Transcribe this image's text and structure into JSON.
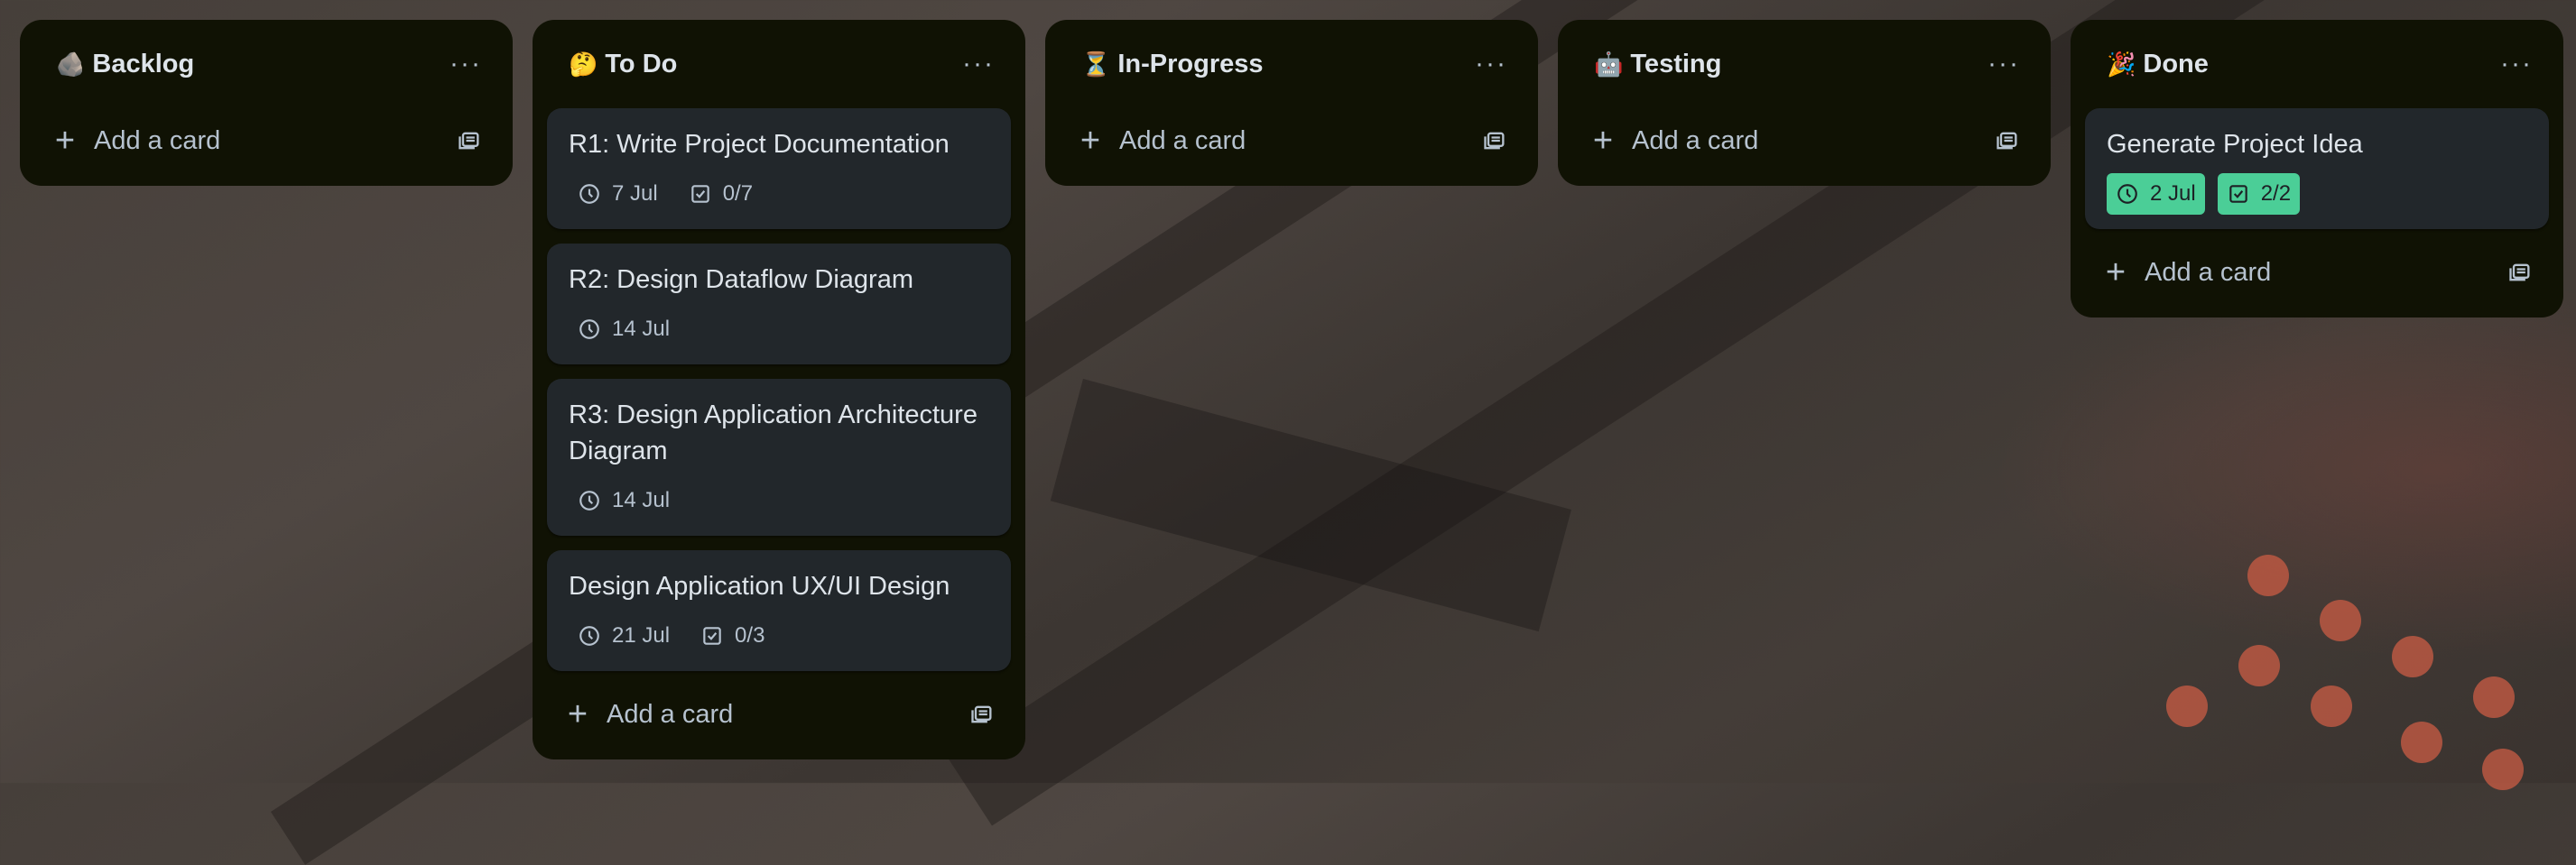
{
  "lists": [
    {
      "id": "backlog",
      "emoji": "🪨",
      "title": "Backlog",
      "add_label": "Add a card",
      "cards": []
    },
    {
      "id": "todo",
      "emoji": "🤔",
      "title": "To Do",
      "add_label": "Add a card",
      "cards": [
        {
          "title": "R1: Write Project Documentation",
          "date": "7 Jul",
          "checklist": "0/7",
          "complete": false
        },
        {
          "title": "R2: Design Dataflow Diagram",
          "date": "14 Jul",
          "checklist": null,
          "complete": false
        },
        {
          "title": "R3: Design Application Architecture Diagram",
          "date": "14 Jul",
          "checklist": null,
          "complete": false
        },
        {
          "title": "Design Application UX/UI Design",
          "date": "21 Jul",
          "checklist": "0/3",
          "complete": false
        }
      ]
    },
    {
      "id": "inprogress",
      "emoji": "⏳",
      "title": "In-Progress",
      "add_label": "Add a card",
      "cards": []
    },
    {
      "id": "testing",
      "emoji": "🤖",
      "title": "Testing",
      "add_label": "Add a card",
      "cards": []
    },
    {
      "id": "done",
      "emoji": "🎉",
      "title": "Done",
      "add_label": "Add a card",
      "cards": [
        {
          "title": "Generate Project Idea",
          "date": "2 Jul",
          "checklist": "2/2",
          "complete": true
        }
      ]
    }
  ],
  "menu_glyph": "···",
  "colors": {
    "list_bg": "#101204",
    "card_bg": "#22272b",
    "text": "#dee4ea",
    "muted": "#b6c2cf",
    "done_badge": "#4bce97"
  },
  "icons": {
    "menu": "more-horizontal-icon",
    "add": "plus-icon",
    "template": "card-template-icon",
    "date": "clock-icon",
    "checklist": "checklist-icon"
  }
}
